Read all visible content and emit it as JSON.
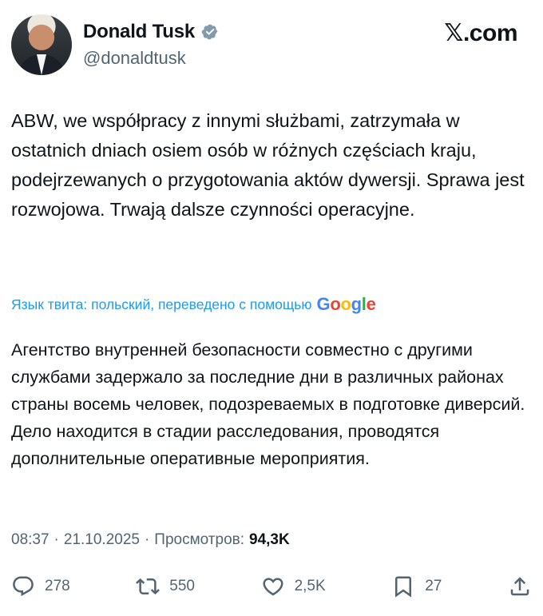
{
  "author": {
    "name": "Donald Tusk",
    "handle": "@donaldtusk",
    "verified": true,
    "verified_color": "#829aab"
  },
  "site_logo": {
    "mark": "𝕏",
    "suffix": ".com"
  },
  "post": {
    "text": "ABW, we współpracy z innymi służbami, zatrzymała w ostatnich dniach osiem osób w różnych częściach kraju, podejrzewanych o przygotowania aktów dywersji. Sprawa jest rozwojowa. Trwają dalsze czynności operacyjne."
  },
  "translation": {
    "label": "Язык твита: польский, переведено с помощью",
    "provider": [
      "G",
      "o",
      "o",
      "g",
      "l",
      "e"
    ],
    "text": "Агентство внутренней безопасности совместно с другими службами задержало за последние дни в различных районах страны восемь человек, подозреваемых в подготовке диверсий. Дело находится в стадии расследования, проводятся дополнительные оперативные мероприятия."
  },
  "meta": {
    "time": "08:37",
    "separator": "·",
    "date": "21.10.2025",
    "views_label": "Просмотров:",
    "views_count": "94,3K"
  },
  "actions": {
    "replies": "278",
    "reposts": "550",
    "likes": "2,5K",
    "bookmarks": "27"
  },
  "colors": {
    "text": "#0f1419",
    "secondary": "#536471",
    "link": "#1d9bf0"
  }
}
